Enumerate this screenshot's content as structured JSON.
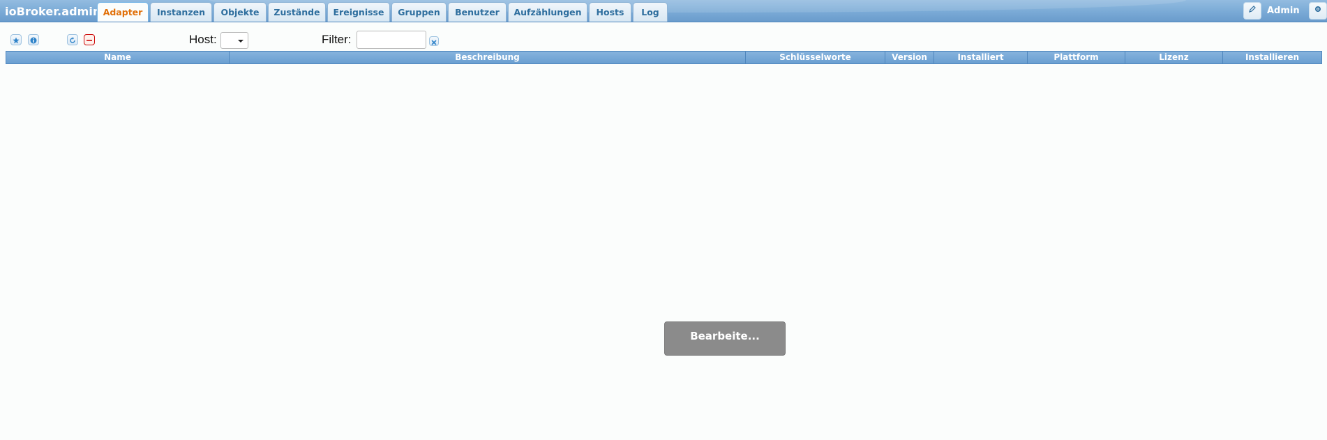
{
  "header": {
    "app_title": "ioBroker.admin",
    "tabs": [
      {
        "label": "Adapter",
        "active": true
      },
      {
        "label": "Instanzen",
        "active": false
      },
      {
        "label": "Objekte",
        "active": false
      },
      {
        "label": "Zustände",
        "active": false
      },
      {
        "label": "Ereignisse",
        "active": false
      },
      {
        "label": "Gruppen",
        "active": false
      },
      {
        "label": "Benutzer",
        "active": false
      },
      {
        "label": "Aufzählungen",
        "active": false
      },
      {
        "label": "Hosts",
        "active": false
      },
      {
        "label": "Log",
        "active": false
      }
    ],
    "user_name": "Admin",
    "edit_icon": "pencil-icon",
    "settings_icon": "gear-icon"
  },
  "toolbar": {
    "host_label": "Host:",
    "host_value": "",
    "filter_label": "Filter:",
    "filter_value": "",
    "buttons": [
      "star-icon",
      "info-icon",
      "refresh-icon",
      "minus-icon",
      "clear-filter-icon"
    ]
  },
  "table": {
    "columns": [
      "Name",
      "Beschreibung",
      "Schlüsselworte",
      "Version",
      "Installiert",
      "Plattform",
      "Lizenz",
      "Installieren"
    ],
    "rows": []
  },
  "loading": {
    "text": "Bearbeite..."
  },
  "colors": {
    "accent_active_tab": "#e17009",
    "header_blue": "#7aaad6",
    "tab_text": "#2e6e9e",
    "overlay_gray": "#8b8b8b"
  }
}
